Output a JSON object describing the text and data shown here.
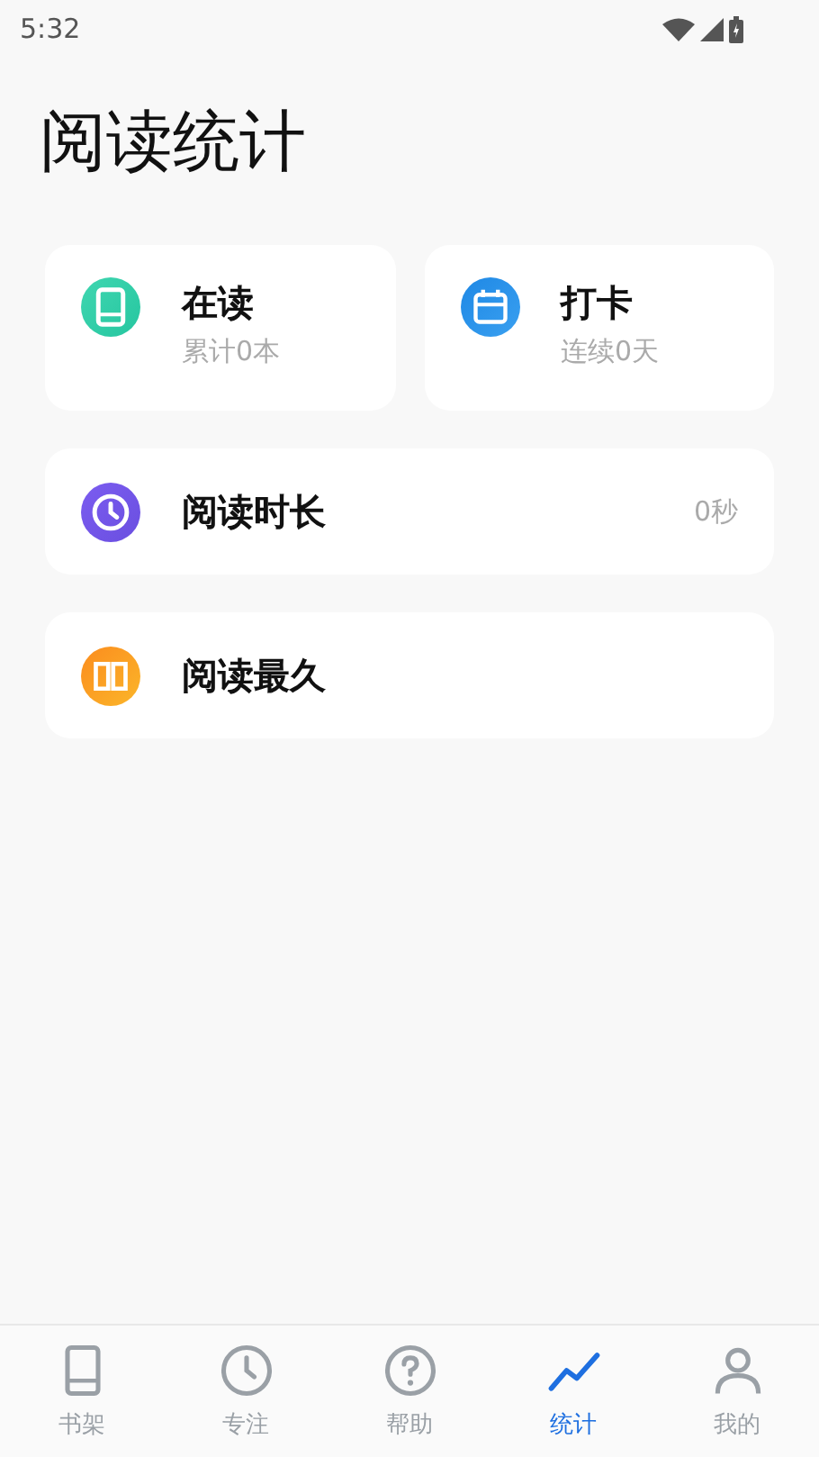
{
  "status_bar": {
    "time": "5:32"
  },
  "title": "阅读统计",
  "summary_cards": [
    {
      "kind": "book",
      "title": "在读",
      "subtitle": "累计0本"
    },
    {
      "kind": "calendar",
      "title": "打卡",
      "subtitle": "连续0天"
    }
  ],
  "stat_rows": [
    {
      "kind": "clock",
      "title": "阅读时长",
      "value": "0秒"
    },
    {
      "kind": "open-book",
      "title": "阅读最久"
    }
  ],
  "tabs": [
    {
      "kind": "shelf",
      "label": "书架",
      "selected": false
    },
    {
      "kind": "focus",
      "label": "专注",
      "selected": false
    },
    {
      "kind": "help",
      "label": "帮助",
      "selected": false
    },
    {
      "kind": "stats",
      "label": "统计",
      "selected": true
    },
    {
      "kind": "me",
      "label": "我的",
      "selected": false
    }
  ]
}
